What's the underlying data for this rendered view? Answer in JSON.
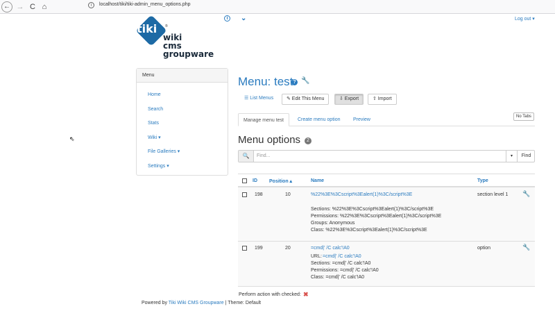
{
  "browser": {
    "url": "localhost/tiki/tiki-admin_menu_options.php",
    "back": "←",
    "forward": "→",
    "reload": "C",
    "home": "⌂",
    "info": "i"
  },
  "topbar": {
    "info_icon": "i",
    "chevron": "⌄",
    "logout": "Log out ▾"
  },
  "logo": {
    "tiki": "tiki",
    "reg": "®",
    "line1": "wiki",
    "line2": "cms",
    "line3": "groupware"
  },
  "sidebar": {
    "title": "Menu",
    "items": [
      {
        "label": "Home"
      },
      {
        "label": "Search"
      },
      {
        "label": "Stats"
      },
      {
        "label": "Wiki ▾"
      },
      {
        "label": "File Galleries ▾"
      },
      {
        "label": "Settings ▾"
      }
    ]
  },
  "main": {
    "title": "Menu: test",
    "help_icon": "?",
    "wrench_icon": "🔧",
    "buttons": {
      "list_menus": "☰ List Menus",
      "edit": "✎ Edit This Menu",
      "export": "⇩ Export",
      "import": "⇧ Import"
    },
    "tabs": [
      "Manage menu test",
      "Create menu option",
      "Preview"
    ],
    "no_tabs": "No Tabs",
    "options_title": "Menu options",
    "options_count": "2",
    "search": {
      "icon": "🔍",
      "placeholder": "Find...",
      "caret": "▾",
      "find": "Find"
    },
    "table": {
      "headers": {
        "id": "ID",
        "position": "Position ▴",
        "name": "Name",
        "type": "Type"
      },
      "rows": [
        {
          "id": "198",
          "position": "10",
          "name": "%22%3E%3Cscript%3Ealert(1)%3C/script%3E",
          "type": "section level 1",
          "details": [
            "Sections: %22%3E%3Cscript%3Ealert(1)%3C/script%3E",
            "Permissions: %22%3E%3Cscript%3Ealert(1)%3C/script%3E",
            "Groups: Anonymous",
            "Class: %22%3E%3Cscript%3Ealert(1)%3C/script%3E"
          ]
        },
        {
          "id": "199",
          "position": "20",
          "name": "=cmd|' /C calc'!A0",
          "type": "option",
          "url_label": "URL:",
          "url_value": "=cmd|' /C calc'!A0",
          "details": [
            "Sections: =cmd|' /C calc'!A0",
            "Permissions: =cmd|' /C calc'!A0",
            "Class: =cmd|' /C calc'!A0"
          ]
        }
      ]
    },
    "perform": "Perform action with checked:",
    "perform_icon": "✖"
  },
  "footer": {
    "prefix": "Powered by ",
    "link": "Tiki Wiki CMS Groupware",
    "suffix": " | Theme: Default"
  },
  "cursor": "⇖"
}
